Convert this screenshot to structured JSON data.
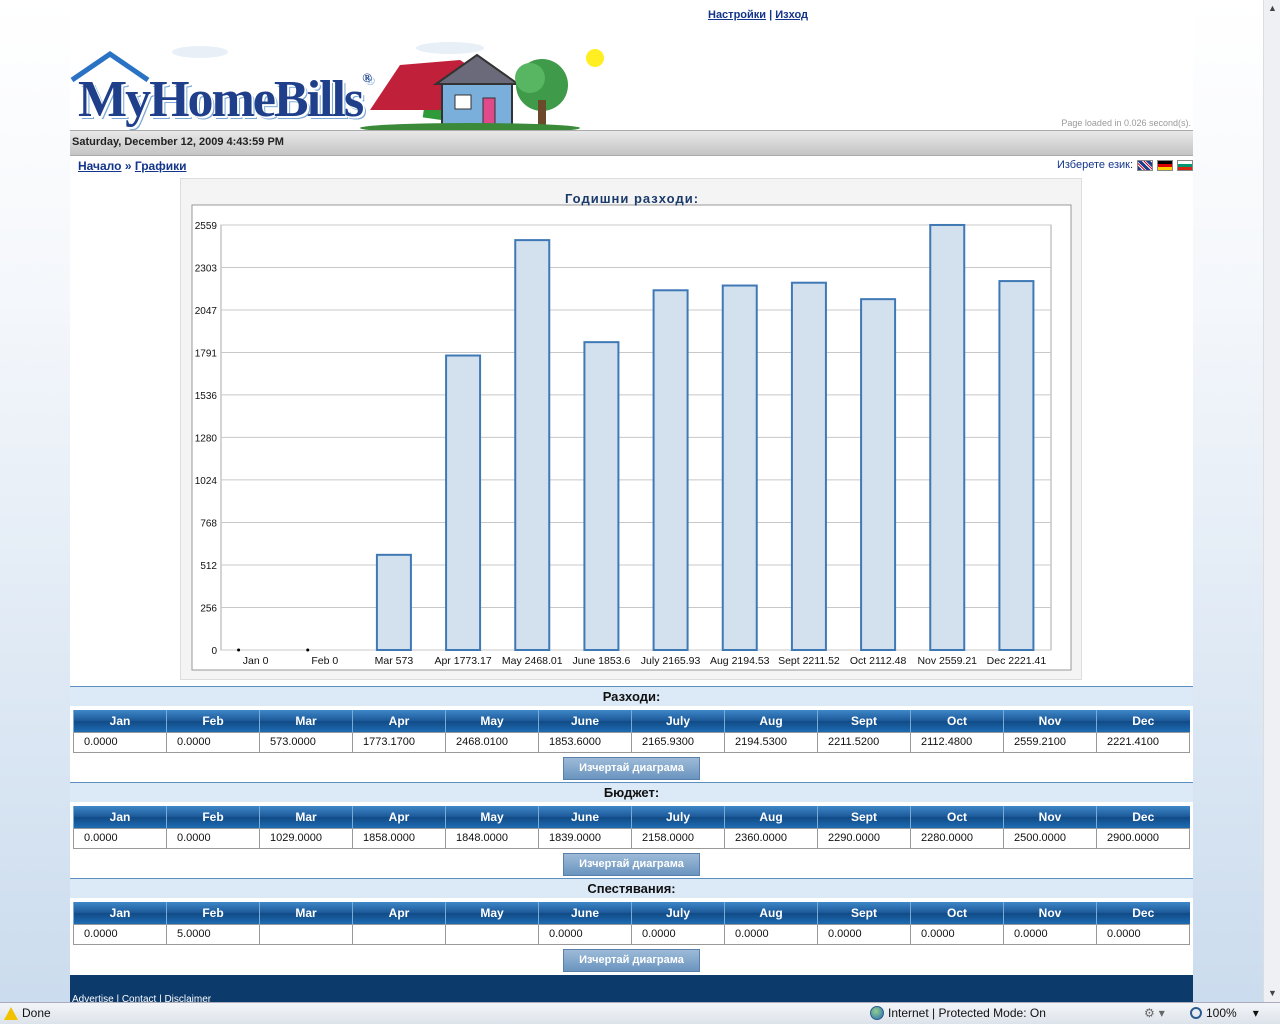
{
  "header": {
    "links": [
      "Настройки",
      "Изход"
    ],
    "separator": "|",
    "logo_text": "MyHomeBills",
    "registered": "®",
    "load_time": "Page loaded in 0.026 second(s).",
    "date": "Saturday, December 12, 2009 4:43:59 PM"
  },
  "breadcrumb": {
    "home": "Начало",
    "sep": "»",
    "current": "Графики"
  },
  "lang": {
    "label": "Изберете език:",
    "flags": [
      "en-flag-icon",
      "de-flag-icon",
      "bg-flag-icon"
    ]
  },
  "chart_data": {
    "type": "bar",
    "title": "Годишни разходи:",
    "categories": [
      "Jan 0",
      "Feb 0",
      "Mar 573",
      "Apr 1773.17",
      "May 2468.01",
      "June 1853.6",
      "July 2165.93",
      "Aug 2194.53",
      "Sept 2211.52",
      "Oct 2112.48",
      "Nov 2559.21",
      "Dec 2221.41"
    ],
    "values": [
      0,
      0,
      573,
      1773.17,
      2468.01,
      1853.6,
      2165.93,
      2194.53,
      2211.52,
      2112.48,
      2559.21,
      2221.41
    ],
    "yticks": [
      0,
      256,
      512,
      768,
      1024,
      1280,
      1536,
      1791,
      2047,
      2303,
      2559
    ],
    "ylim": [
      0,
      2559
    ],
    "xlabel": "",
    "ylabel": "",
    "grid": true,
    "bar_color": "#d3e1ee",
    "bar_border": "#3f79b5"
  },
  "months": [
    "Jan",
    "Feb",
    "Mar",
    "Apr",
    "May",
    "June",
    "July",
    "Aug",
    "Sept",
    "Oct",
    "Nov",
    "Dec"
  ],
  "sections": [
    {
      "title": "Разходи:",
      "values": [
        "0.0000",
        "0.0000",
        "573.0000",
        "1773.1700",
        "2468.0100",
        "1853.6000",
        "2165.9300",
        "2194.5300",
        "2211.5200",
        "2112.4800",
        "2559.2100",
        "2221.4100"
      ],
      "button": "Изчертай диаграма"
    },
    {
      "title": "Бюджет:",
      "values": [
        "0.0000",
        "0.0000",
        "1029.0000",
        "1858.0000",
        "1848.0000",
        "1839.0000",
        "2158.0000",
        "2360.0000",
        "2290.0000",
        "2280.0000",
        "2500.0000",
        "2900.0000"
      ],
      "button": "Изчертай диаграма"
    },
    {
      "title": "Спестявания:",
      "values": [
        "0.0000",
        "5.0000",
        "",
        "",
        "",
        "0.0000",
        "0.0000",
        "0.0000",
        "0.0000",
        "0.0000",
        "0.0000",
        "0.0000"
      ],
      "button": "Изчертай диаграма"
    }
  ],
  "footer": {
    "text": "Advertise | Contact | Disclaimer"
  },
  "statusbar": {
    "done": "Done",
    "zone": "Internet | Protected Mode: On",
    "zoom": "100%"
  }
}
